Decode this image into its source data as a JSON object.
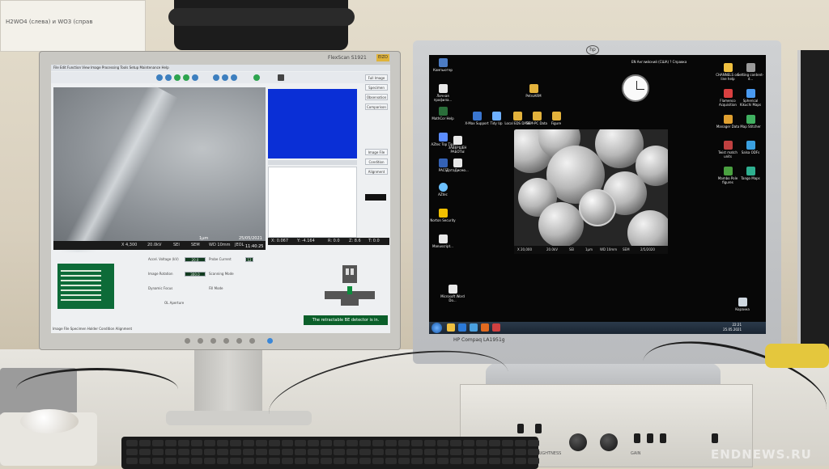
{
  "wall_poster": {
    "text": "H2WO4 (слева) и WO3 (справ"
  },
  "left_monitor": {
    "brand": "FlexScan S1921",
    "badge": "EIZO",
    "sem_app": {
      "menu": "File  Edit  Function  View  Image Processing  Tools  Setup  Maintenance  Help",
      "infobar": [
        "X 4,300",
        "20.0kV",
        "SEI",
        "SEM",
        "WD 10mm",
        "JEOL",
        "25/05/2021",
        "11:40:25"
      ],
      "scale": "1μm",
      "coordbar": [
        "X: 0.067",
        "Y: -4.164",
        "R: 0.0",
        "Z: 8.6",
        "T: 0.0"
      ],
      "side_buttons": [
        "Full Image",
        "Specimen",
        "Observation",
        "Comparison",
        "Image File",
        "Condition",
        "Alignment"
      ],
      "bottom_fields": [
        "Accel. Voltage (kV)",
        "Image Rotation",
        "Dynamic Focus",
        "Probe Current",
        "Scanning Mode",
        "Fill Mode",
        "OL Aperture"
      ],
      "bottom_values": [
        "20.0",
        "300.0",
        "12"
      ],
      "bse_message": "The retractable BE detector is in.",
      "tabs": "Image File   Specimen   Holder   Condition   Alignment"
    }
  },
  "right_monitor": {
    "logo": "hp",
    "model_label": "HP Compaq LA1951g",
    "desktop_icons_left": [
      "Компьютер",
      "Личная профила...",
      "MathCor Help",
      "AZtec Top Tips",
      "PACS",
      "AZtec",
      "Norton Security",
      "Microsoft Word Do...",
      "Manuscript..."
    ],
    "desktop_icons_top": [
      "PetroARM",
      "X-Max Support",
      "Tidy Up",
      "Local EDS DATA",
      "SEM-PC Data",
      "Figure",
      "ЗАВЕРШЕН РАБОТЫ",
      "ДатаДисмо..."
    ],
    "desktop_icons_right": [
      "CHANNELS on-line help",
      "Setting content-d...",
      "Flamenco Acquisition",
      "Spherical Kikuchi Maps",
      "Manager Data",
      "Map Stitcher",
      "Twist match units",
      "Salsa ODFs",
      "Mambo Pole figures",
      "Tango Maps",
      "Корзина"
    ],
    "micrograph_bar": [
      "X 20,000",
      "20.0kV",
      "SEI",
      "1μm",
      "WD 10mm",
      "SEM",
      "2/5/2020"
    ],
    "taskbar_time": "22:21",
    "taskbar_date": "25.05.2021",
    "input_lang": "EN Английский (США) ? Справка"
  },
  "controller": {
    "brightness": "BRIGHTNESS",
    "gain": "GAIN"
  },
  "watermark": "ENDNEWS.RU"
}
